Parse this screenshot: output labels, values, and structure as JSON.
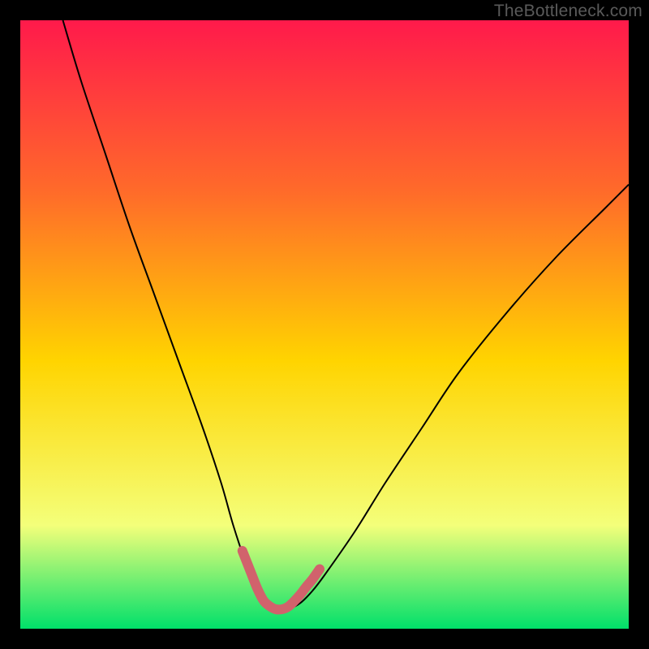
{
  "watermark": "TheBottleneck.com",
  "chart_data": {
    "type": "line",
    "title": "",
    "xlabel": "",
    "ylabel": "",
    "xlim": [
      0,
      100
    ],
    "ylim": [
      0,
      100
    ],
    "grid": false,
    "background_gradient": {
      "top": "#ff1a4b",
      "upper_mid": "#ff6a2a",
      "mid": "#ffd400",
      "lower_mid": "#f4ff7a",
      "bottom": "#00e06a"
    },
    "series": [
      {
        "name": "bottleneck-curve",
        "stroke": "#000000",
        "stroke_width": 2,
        "x": [
          7,
          10,
          14,
          18,
          22,
          26,
          30,
          33,
          35,
          37,
          39,
          40.5,
          42,
          44,
          46,
          48,
          50,
          55,
          60,
          66,
          72,
          80,
          88,
          96,
          100
        ],
        "values": [
          100,
          90,
          78,
          66,
          55,
          44,
          33,
          24,
          17,
          11,
          6,
          3.5,
          3,
          3.2,
          4.2,
          6.2,
          8.8,
          16,
          24,
          33,
          42,
          52,
          61,
          69,
          73
        ]
      },
      {
        "name": "optimal-zone-highlight",
        "stroke": "#d1626c",
        "stroke_width": 12,
        "linecap": "round",
        "x": [
          36.5,
          38.0,
          39.0,
          40.0,
          41.0,
          42.0,
          43.0,
          44.0,
          45.0,
          46.0,
          47.0,
          48.0,
          49.2
        ],
        "values": [
          12.8,
          9.0,
          6.5,
          4.6,
          3.7,
          3.2,
          3.2,
          3.6,
          4.5,
          5.6,
          6.9,
          8.1,
          9.8
        ]
      }
    ]
  }
}
